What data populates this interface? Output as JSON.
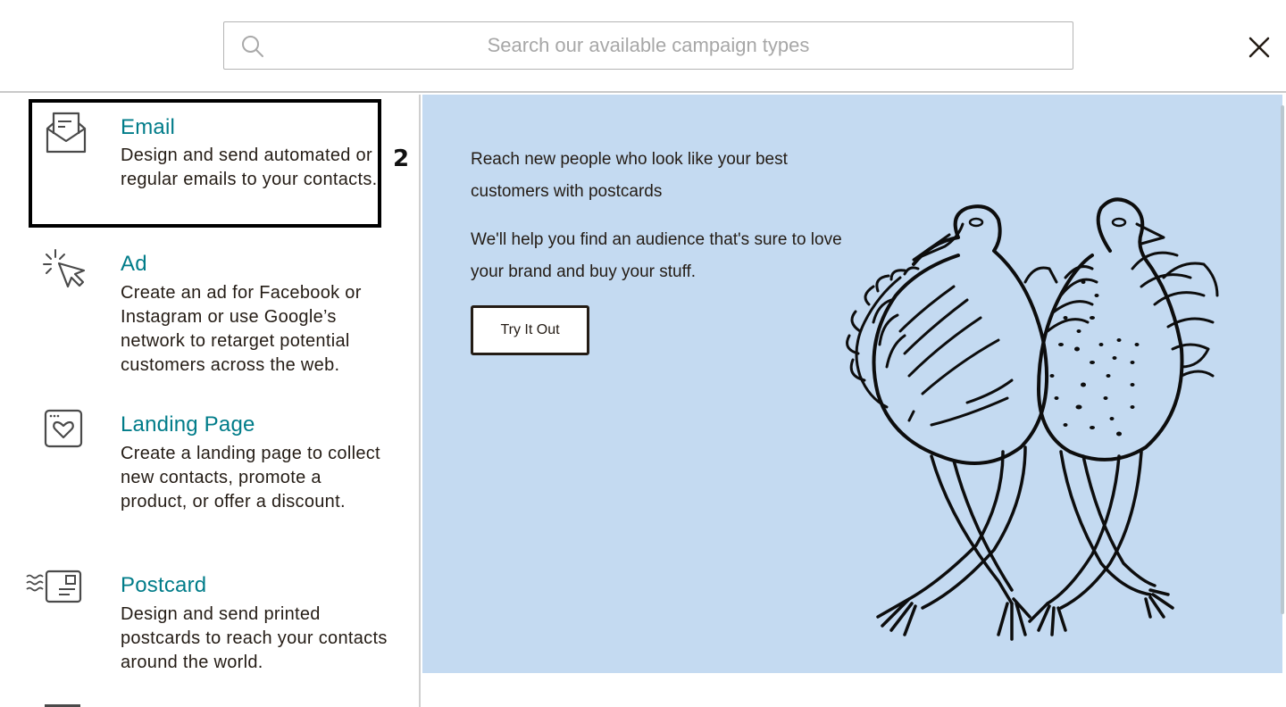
{
  "search": {
    "placeholder": "Search our available campaign types",
    "value": "",
    "icon": "search-icon"
  },
  "close": {
    "icon": "close-icon",
    "label": "Close"
  },
  "annotation": {
    "label": "2"
  },
  "campaign_types": [
    {
      "icon": "envelope-open-icon",
      "title": "Email",
      "description": "Design and send automated or regular emails to your contacts.",
      "highlighted": true
    },
    {
      "icon": "cursor-click-icon",
      "title": "Ad",
      "description": "Create an ad for Facebook or Instagram or use Google’s network to retarget potential customers across the web."
    },
    {
      "icon": "browser-heart-icon",
      "title": "Landing Page",
      "description": "Create a landing page to collect new contacts, promote a product, or offer a discount."
    },
    {
      "icon": "postcard-icon",
      "title": "Postcard",
      "description": "Design and send printed postcards to reach your contacts around the world."
    }
  ],
  "promo": {
    "headline": "Reach new people who look like your best customers with postcards",
    "body": "We'll help you find an audience that's sure to love your brand and buy your stuff.",
    "button_label": "Try It Out",
    "illustration": "two-birds-illustration",
    "background_color": "#c4daf1"
  },
  "colors": {
    "title_accent": "#007c89",
    "text": "#241c15"
  }
}
